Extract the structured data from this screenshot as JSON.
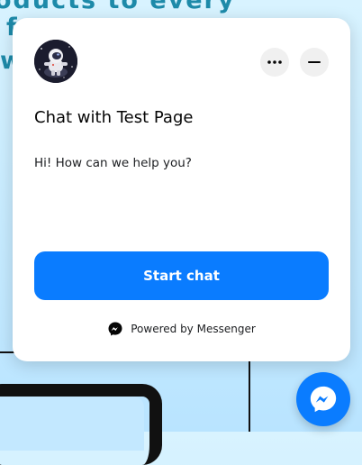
{
  "background": {
    "heading_line1": "oducts to every",
    "heading_frag2": "f",
    "heading_frag3": "w"
  },
  "chat": {
    "title": "Chat with Test Page",
    "greeting": "Hi! How can we help you?",
    "start_button": "Start chat",
    "powered_by": "Powered by Messenger",
    "accent_color": "#0a7cff",
    "icons": {
      "avatar": "astronaut-avatar",
      "more": "more-horizontal-icon",
      "minimize": "minimize-icon",
      "powered": "messenger-icon",
      "launcher": "messenger-icon"
    }
  }
}
